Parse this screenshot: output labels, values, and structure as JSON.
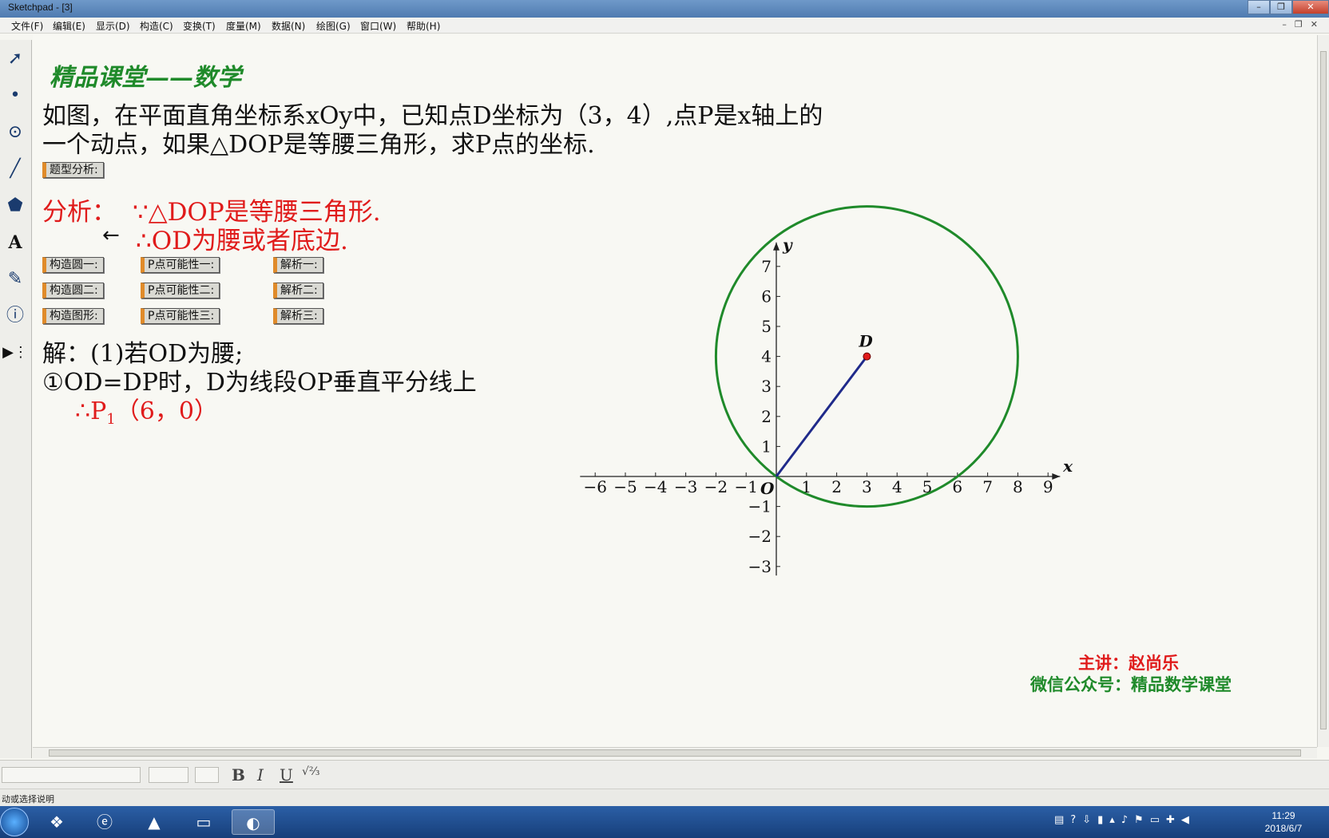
{
  "window": {
    "title": "Sketchpad - [3]"
  },
  "menu": [
    "文件(F)",
    "编辑(E)",
    "显示(D)",
    "构造(C)",
    "变换(T)",
    "度量(M)",
    "数据(N)",
    "绘图(G)",
    "窗口(W)",
    "帮助(H)"
  ],
  "content": {
    "heading": "精品课堂——数学",
    "problem_line1": "如图，在平面直角坐标系xOy中，已知点D坐标为（3，4）,点P是x轴上的",
    "problem_line2": "一个动点，如果△DOP是等腰三角形，求P点的坐标.",
    "analysis_label": "分析：",
    "analysis_line1": "∵△DOP是等腰三角形.",
    "analysis_line2": "∴OD为腰或者底边.",
    "solution_line1": "解：(1)若OD为腰;",
    "solution_line2": "①OD=DP时，D为线段OP垂直平分线上",
    "solution_line3_prefix": "∴P",
    "solution_line3_sub": "1",
    "solution_line3_rest": "（6，0）"
  },
  "buttons": {
    "type_analysis": "题型分析:",
    "circle1": "构造圆一:",
    "circle2": "构造圆二:",
    "shape": "构造图形:",
    "p1": "P点可能性一:",
    "p2": "P点可能性二:",
    "p3": "P点可能性三:",
    "sol1": "解析一:",
    "sol2": "解析二:",
    "sol3": "解析三:"
  },
  "graph": {
    "x_axis_label": "x",
    "y_axis_label": "y",
    "origin_label": "O",
    "point_label": "D",
    "x_ticks": [
      -6,
      -5,
      -4,
      -3,
      -2,
      -1,
      1,
      2,
      3,
      4,
      5,
      6,
      7,
      8,
      9
    ],
    "y_ticks": [
      -3,
      -2,
      -1,
      1,
      2,
      3,
      4,
      5,
      6,
      7
    ],
    "point_D": [
      3,
      4
    ],
    "circle_center": [
      3,
      4
    ],
    "circle_radius": 5,
    "circle_color": "#1f8a2a",
    "segment_color": "#1f2a8a",
    "point_color": "#e01b1b"
  },
  "credits": {
    "lecturer": "主讲：赵尚乐",
    "wechat": "微信公众号：精品数学课堂"
  },
  "status": {
    "text": "动或选择说明"
  },
  "clock": {
    "time": "11:29",
    "date": "2018/6/7"
  }
}
